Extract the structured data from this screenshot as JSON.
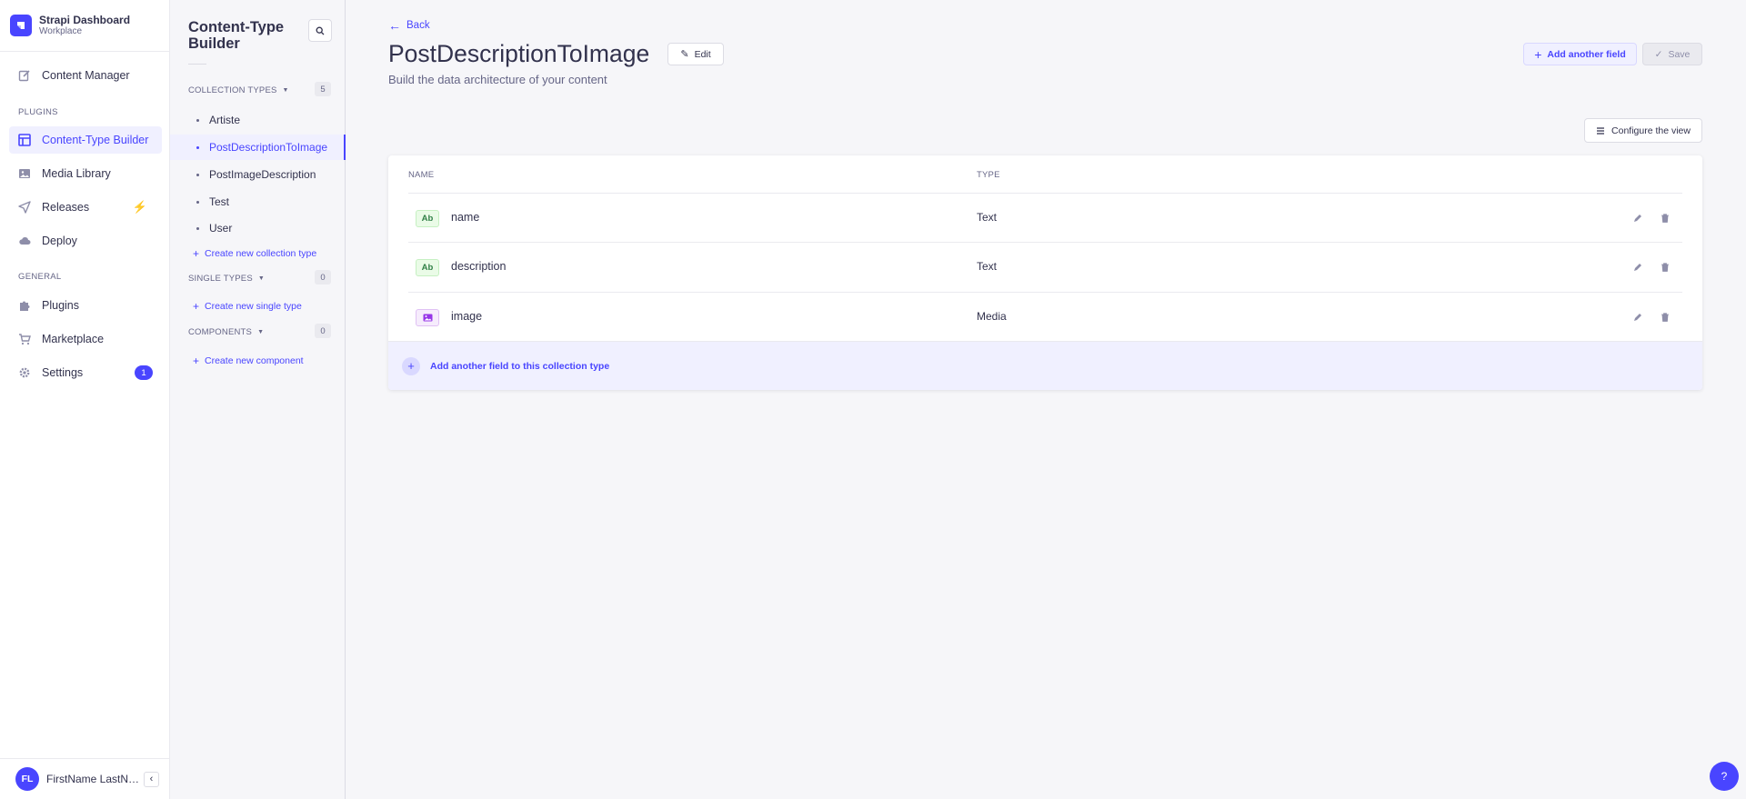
{
  "brand": {
    "title": "Strapi Dashboard",
    "subtitle": "Workplace"
  },
  "mainnav": {
    "content_manager": "Content Manager",
    "plugins_section": "PLUGINS",
    "content_type_builder": "Content-Type Builder",
    "media_library": "Media Library",
    "releases": "Releases",
    "deploy": "Deploy",
    "general_section": "GENERAL",
    "plugins": "Plugins",
    "marketplace": "Marketplace",
    "settings": "Settings",
    "settings_badge": "1"
  },
  "user": {
    "initials": "FL",
    "name": "FirstName LastName"
  },
  "subnav": {
    "title": "Content-Type Builder",
    "collection_types": {
      "label": "COLLECTION TYPES",
      "count": "5",
      "items": [
        "Artiste",
        "PostDescriptionToImage",
        "PostImageDescription",
        "Test",
        "User"
      ],
      "create": "Create new collection type"
    },
    "single_types": {
      "label": "SINGLE TYPES",
      "count": "0",
      "create": "Create new single type"
    },
    "components": {
      "label": "COMPONENTS",
      "count": "0",
      "create": "Create new component"
    }
  },
  "main": {
    "back": "Back",
    "title": "PostDescriptionToImage",
    "edit": "Edit",
    "subtitle": "Build the data architecture of your content",
    "add_field": "Add another field",
    "save": "Save",
    "configure_view": "Configure the view",
    "table": {
      "headers": {
        "name": "NAME",
        "type": "TYPE"
      },
      "rows": [
        {
          "icon": "Ab",
          "kind": "text",
          "name": "name",
          "type": "Text"
        },
        {
          "icon": "Ab",
          "kind": "text",
          "name": "description",
          "type": "Text"
        },
        {
          "icon": "media-icon",
          "kind": "media",
          "name": "image",
          "type": "Media"
        }
      ],
      "add_field_row": "Add another field to this collection type"
    }
  },
  "help": "?",
  "colors": {
    "primary": "#4945ff",
    "primary_light": "#f0f0ff",
    "text_field": "#328048",
    "media_field": "#9736e8",
    "bolt": "#f29d41"
  }
}
